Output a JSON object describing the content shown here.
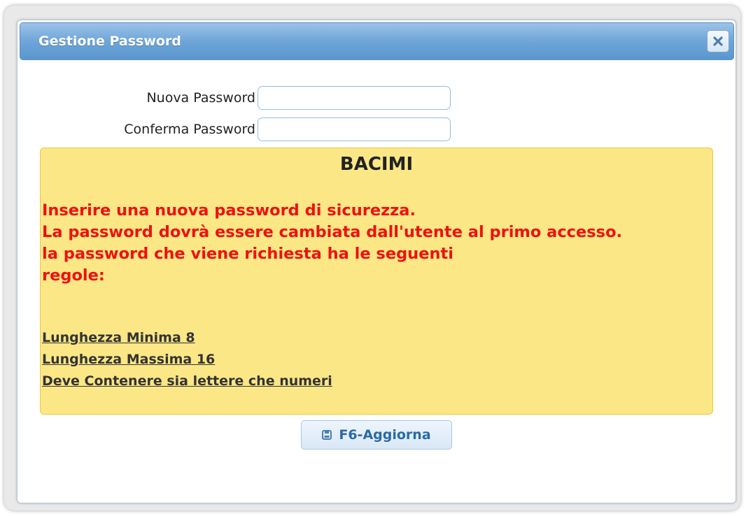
{
  "dialog": {
    "title": "Gestione Password",
    "close_icon": "close-icon"
  },
  "form": {
    "new_password_label": "Nuova Password",
    "new_password_value": "",
    "confirm_password_label": "Conferma Password",
    "confirm_password_value": ""
  },
  "notice": {
    "title": "BACIMI",
    "message_lines": [
      "Inserire una nuova password di sicurezza.",
      "La password dovrà essere cambiata dall'utente al primo accesso.",
      "la password che viene richiesta ha le seguenti",
      "regole:"
    ],
    "rules": [
      "Lunghezza Minima 8",
      "Lunghezza Massima 16",
      "Deve Contenere sia lettere che numeri"
    ],
    "background_color": "#fbe786",
    "message_color": "#ee1111"
  },
  "actions": {
    "update_label": "F6-Aggiorna",
    "update_icon": "save-icon"
  }
}
